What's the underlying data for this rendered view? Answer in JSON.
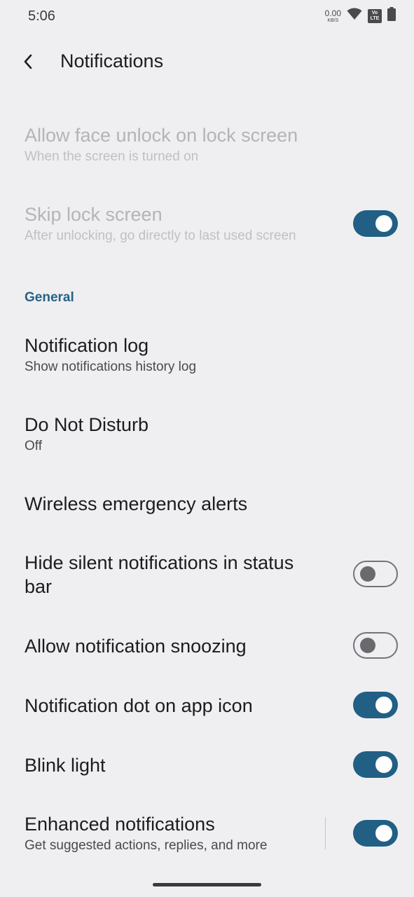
{
  "status_bar": {
    "time": "5:06",
    "net_speed_value": "0.00",
    "net_speed_unit": "KB/S",
    "volte_top": "Vo",
    "volte_bottom": "LTE",
    "icons": [
      "wifi-icon",
      "volte-icon",
      "battery-icon"
    ]
  },
  "app_bar": {
    "title": "Notifications",
    "back_icon": "chevron-left-icon"
  },
  "lock_screen": {
    "face_unlock": {
      "title": "Allow face unlock on lock screen",
      "subtitle": "When the screen is turned on",
      "enabled": false
    },
    "skip_lock": {
      "title": "Skip lock screen",
      "subtitle": "After unlocking, go directly to last used screen",
      "enabled": false,
      "checked": true
    }
  },
  "general": {
    "header": "General",
    "notification_log": {
      "title": "Notification log",
      "subtitle": "Show notifications history log"
    },
    "do_not_disturb": {
      "title": "Do Not Disturb",
      "subtitle": "Off"
    },
    "emergency_alerts": {
      "title": "Wireless emergency alerts"
    },
    "hide_silent": {
      "title_line1": "Hide silent notifications in status",
      "title_line2": "bar",
      "checked": false
    },
    "snoozing": {
      "title": "Allow notification snoozing",
      "checked": false
    },
    "dot": {
      "title": "Notification dot on app icon",
      "checked": true
    },
    "blink": {
      "title": "Blink light",
      "checked": true
    },
    "enhanced": {
      "title": "Enhanced notifications",
      "subtitle": "Get suggested actions, replies, and more",
      "checked": true
    }
  },
  "colors": {
    "accent": "#215f85",
    "section_header": "#276286",
    "background": "#efeff2"
  }
}
